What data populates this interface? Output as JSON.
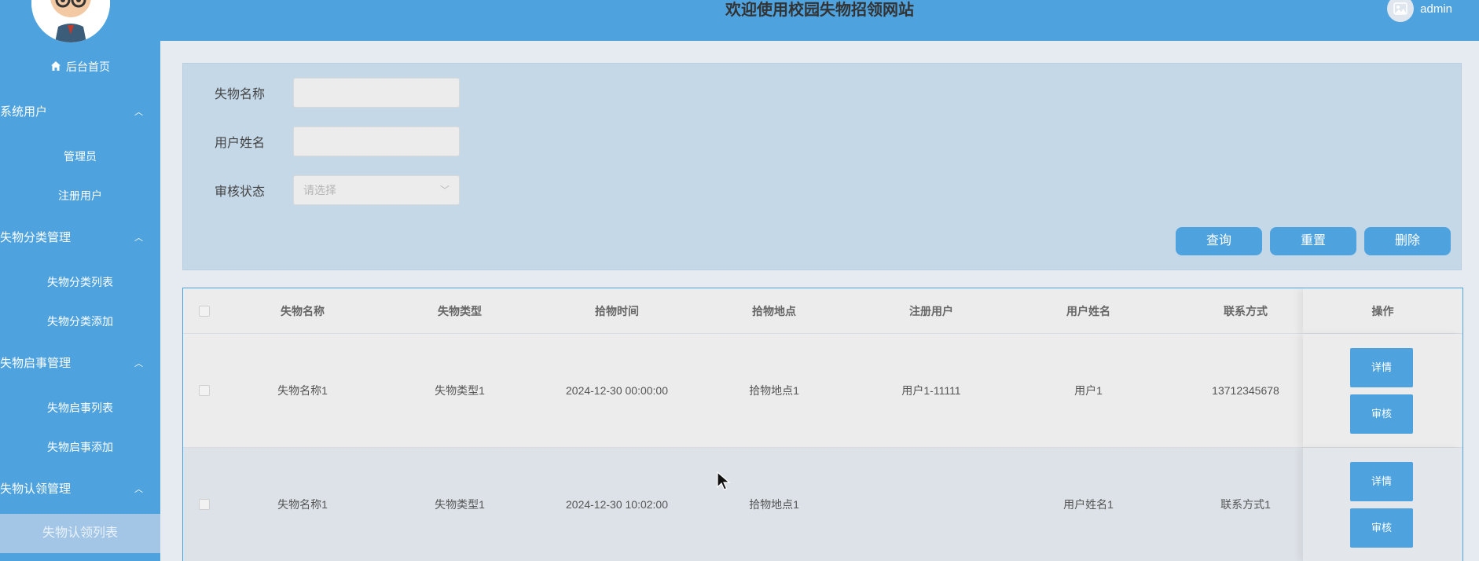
{
  "header": {
    "title": "欢迎使用校园失物招领网站",
    "user": "admin"
  },
  "sidebar": {
    "home": "后台首页",
    "groups": [
      {
        "label": "系统用户",
        "items": [
          "管理员",
          "注册用户"
        ]
      },
      {
        "label": "失物分类管理",
        "items": [
          "失物分类列表",
          "失物分类添加"
        ]
      },
      {
        "label": "失物启事管理",
        "items": [
          "失物启事列表",
          "失物启事添加"
        ]
      },
      {
        "label": "失物认领管理",
        "items": [
          "失物认领列表"
        ]
      }
    ],
    "active": "失物认领列表"
  },
  "search": {
    "fields": [
      {
        "label": "失物名称",
        "value": ""
      },
      {
        "label": "用户姓名",
        "value": ""
      },
      {
        "label": "审核状态",
        "placeholder": "请选择"
      }
    ],
    "buttons": {
      "query": "查询",
      "reset": "重置",
      "delete": "删除"
    }
  },
  "table": {
    "columns": [
      "失物名称",
      "失物类型",
      "拾物时间",
      "拾物地点",
      "注册用户",
      "用户姓名",
      "联系方式",
      "操作"
    ],
    "rows": [
      {
        "name": "失物名称1",
        "type": "失物类型1",
        "time": "2024-12-30 00:00:00",
        "place": "拾物地点1",
        "reg_user": "用户1-11111",
        "user_name": "用户1",
        "contact": "13712345678"
      },
      {
        "name": "失物名称1",
        "type": "失物类型1",
        "time": "2024-12-30 10:02:00",
        "place": "拾物地点1",
        "reg_user": "",
        "user_name": "用户姓名1",
        "contact": "联系方式1"
      }
    ],
    "row_actions": {
      "detail": "详情",
      "review": "审核"
    }
  },
  "colors": {
    "primary": "#4ea3df",
    "panel": "#c5d8e7",
    "active_menu": "#a4c6e6"
  },
  "icons": [
    "home-icon",
    "chevron-up-icon",
    "chevron-down-icon",
    "user-avatar-icon",
    "mouse-cursor-icon"
  ]
}
